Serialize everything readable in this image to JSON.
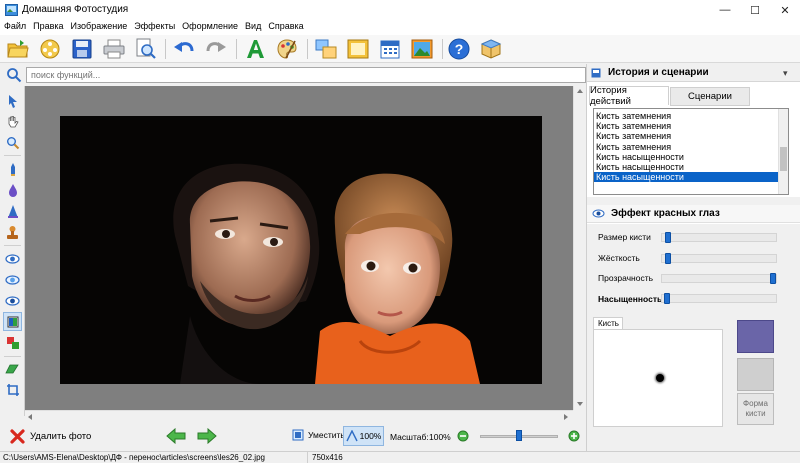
{
  "window": {
    "title": "Домашняя Фотостудия",
    "controls": {
      "minimize": "—",
      "maximize": "☐",
      "close": "✕"
    }
  },
  "menu": [
    "Файл",
    "Правка",
    "Изображение",
    "Эффекты",
    "Оформление",
    "Вид",
    "Справка"
  ],
  "search": {
    "placeholder": "поиск функций..."
  },
  "history_panel": {
    "title": "История и сценарии",
    "tabs": [
      "История действий",
      "Сценарии"
    ],
    "items": [
      "Кисть затемнения",
      "Кисть затемнения",
      "Кисть затемнения",
      "Кисть затемнения",
      "Кисть насыщенности",
      "Кисть насыщенности",
      "Кисть насыщенности"
    ],
    "selected_index": 6
  },
  "effect_panel": {
    "title": "Эффект красных глаз",
    "sliders": [
      {
        "label": "Размер кисти",
        "value": 0.03,
        "bold": false
      },
      {
        "label": "Жёсткость",
        "value": 0.03,
        "bold": false
      },
      {
        "label": "Прозрачность",
        "value": 1.0,
        "bold": false
      },
      {
        "label": "Насыщенность",
        "value": 0.02,
        "bold": true
      }
    ],
    "brush_label": "Кисть",
    "shape_button": "Форма кисти",
    "primary_color": "#6a65a8",
    "secondary_color": "#cfcfcf"
  },
  "bottom": {
    "delete_label": "Удалить фото",
    "fit_label": "Уместить",
    "zoom100_label": "100%",
    "scale_label": "Масштаб:",
    "scale_value": "100%",
    "zoom_slider_value": 0.5
  },
  "status": {
    "path": "C:\\Users\\AMS-Elena\\Desktop\\ДФ - перенос\\articles\\screens\\les26_02.jpg",
    "dimensions": "750x416"
  }
}
